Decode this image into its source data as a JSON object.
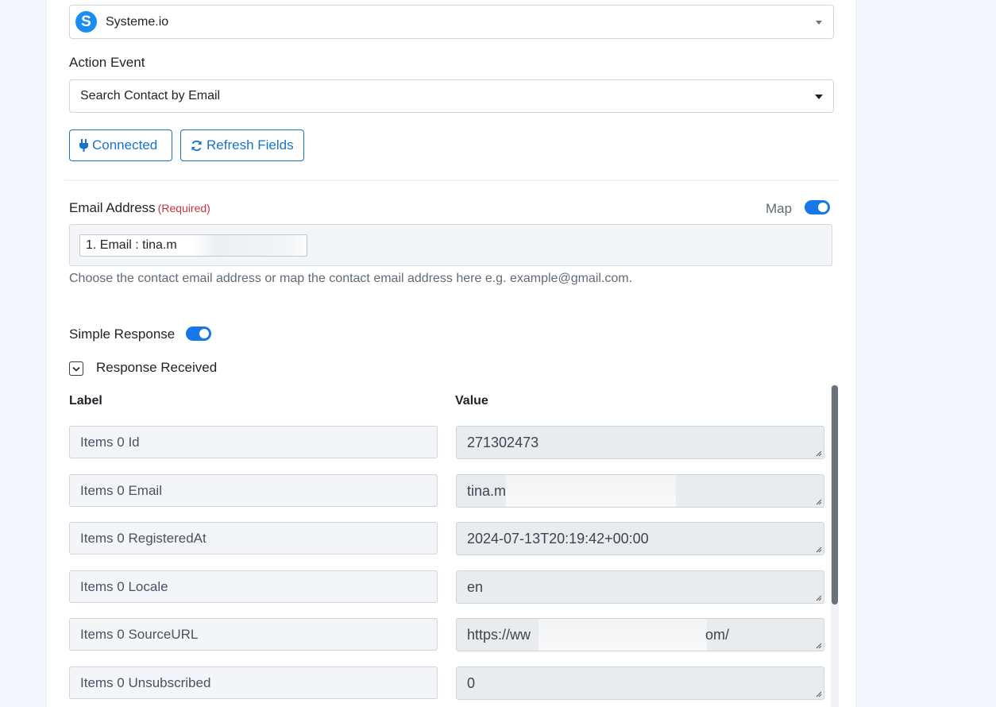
{
  "app_select": {
    "logo_letter": "S",
    "value": "Systeme.io"
  },
  "action_event": {
    "label": "Action Event",
    "value": "Search Contact by Email"
  },
  "buttons": {
    "connected": "Connected",
    "refresh": "Refresh Fields"
  },
  "email_field": {
    "label": "Email Address",
    "required": "(Required)",
    "map_label": "Map",
    "map_enabled": true,
    "chip_value": "1. Email : tina.m",
    "help": "Choose the contact email address or map the contact email address here e.g. example@gmail.com."
  },
  "simple_response": {
    "label": "Simple Response",
    "enabled": true
  },
  "response_received": {
    "label": "Response Received"
  },
  "table": {
    "label_header": "Label",
    "value_header": "Value",
    "rows": [
      {
        "label": "Items 0 Id",
        "value": "271302473"
      },
      {
        "label": "Items 0 Email",
        "value": "tina.m"
      },
      {
        "label": "Items 0 RegisteredAt",
        "value": "2024-07-13T20:19:42+00:00"
      },
      {
        "label": "Items 0 Locale",
        "value": "en"
      },
      {
        "label": "Items 0 SourceURL",
        "value": "https://ww",
        "value_suffix": "om/"
      },
      {
        "label": "Items 0 Unsubscribed",
        "value": "0"
      }
    ]
  },
  "colors": {
    "accent": "#1a73c9",
    "toggle": "#1877e8",
    "required": "#c53543"
  },
  "icons": [
    "chevron-down-icon",
    "plug-icon",
    "refresh-icon",
    "resize-handle-icon"
  ]
}
